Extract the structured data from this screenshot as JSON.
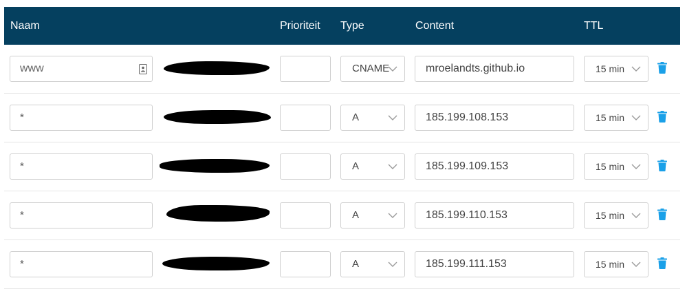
{
  "header": {
    "naam": "Naam",
    "prioriteit": "Prioriteit",
    "type": "Type",
    "content": "Content",
    "ttl": "TTL"
  },
  "rows": [
    {
      "name": "www",
      "type": "CNAME",
      "content": "mroelandts.github.io",
      "ttl": "15 min"
    },
    {
      "name": "*",
      "type": "A",
      "content": "185.199.108.153",
      "ttl": "15 min"
    },
    {
      "name": "*",
      "type": "A",
      "content": "185.199.109.153",
      "ttl": "15 min"
    },
    {
      "name": "*",
      "type": "A",
      "content": "185.199.110.153",
      "ttl": "15 min"
    },
    {
      "name": "*",
      "type": "A",
      "content": "185.199.111.153",
      "ttl": "15 min"
    }
  ],
  "colors": {
    "header_bg": "#05405f",
    "trash_icon": "#1aa0e8",
    "chevron": "#9a9a9a",
    "redaction": "#000000"
  },
  "icons": [
    "vcard-icon",
    "chevron-down-icon",
    "trash-icon"
  ]
}
